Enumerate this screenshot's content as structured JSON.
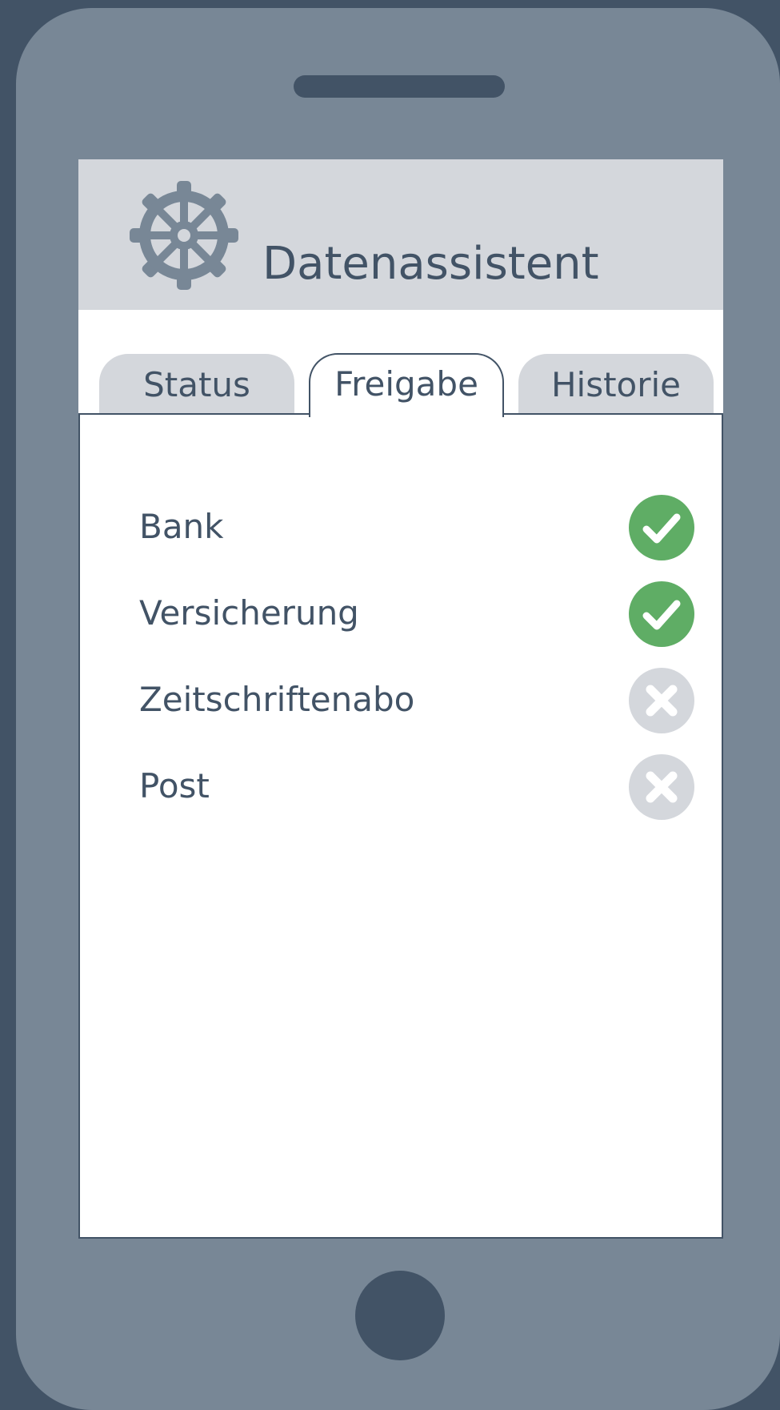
{
  "app": {
    "title": "Datenassistent",
    "logo_icon": "ship-wheel-icon"
  },
  "colors": {
    "frame": "#425366",
    "phone_body": "#788796",
    "header_bg": "#d4d7dc",
    "accent_text": "#425366",
    "granted": "#5fad65",
    "denied": "#d4d7dc"
  },
  "tabs": [
    {
      "label": "Status",
      "active": false
    },
    {
      "label": "Freigabe",
      "active": true
    },
    {
      "label": "Historie",
      "active": false
    }
  ],
  "items": [
    {
      "label": "Bank",
      "status": "granted",
      "icon": "check-circle-icon"
    },
    {
      "label": "Versicherung",
      "status": "granted",
      "icon": "check-circle-icon"
    },
    {
      "label": "Zeitschriftenabo",
      "status": "denied",
      "icon": "x-circle-icon"
    },
    {
      "label": "Post",
      "status": "denied",
      "icon": "x-circle-icon"
    }
  ]
}
